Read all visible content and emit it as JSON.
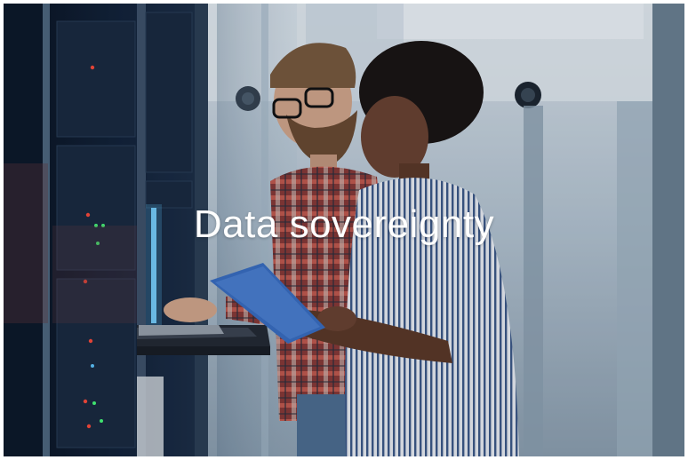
{
  "slide": {
    "headline": "Data sovereignty"
  },
  "photo": {
    "subject": "server-room-photo",
    "colors": {
      "rack_dark": "#0f1c2e",
      "corridor_light": "#c4d2de",
      "led_red": "#ff4a3a",
      "led_green": "#48ff7a",
      "led_blue": "#5fc8ff",
      "shirt_plaid_red": "#b6473f",
      "shirt_stripe_blue": "#3e5b8a",
      "tablet_blue": "#3a6fc4"
    }
  }
}
